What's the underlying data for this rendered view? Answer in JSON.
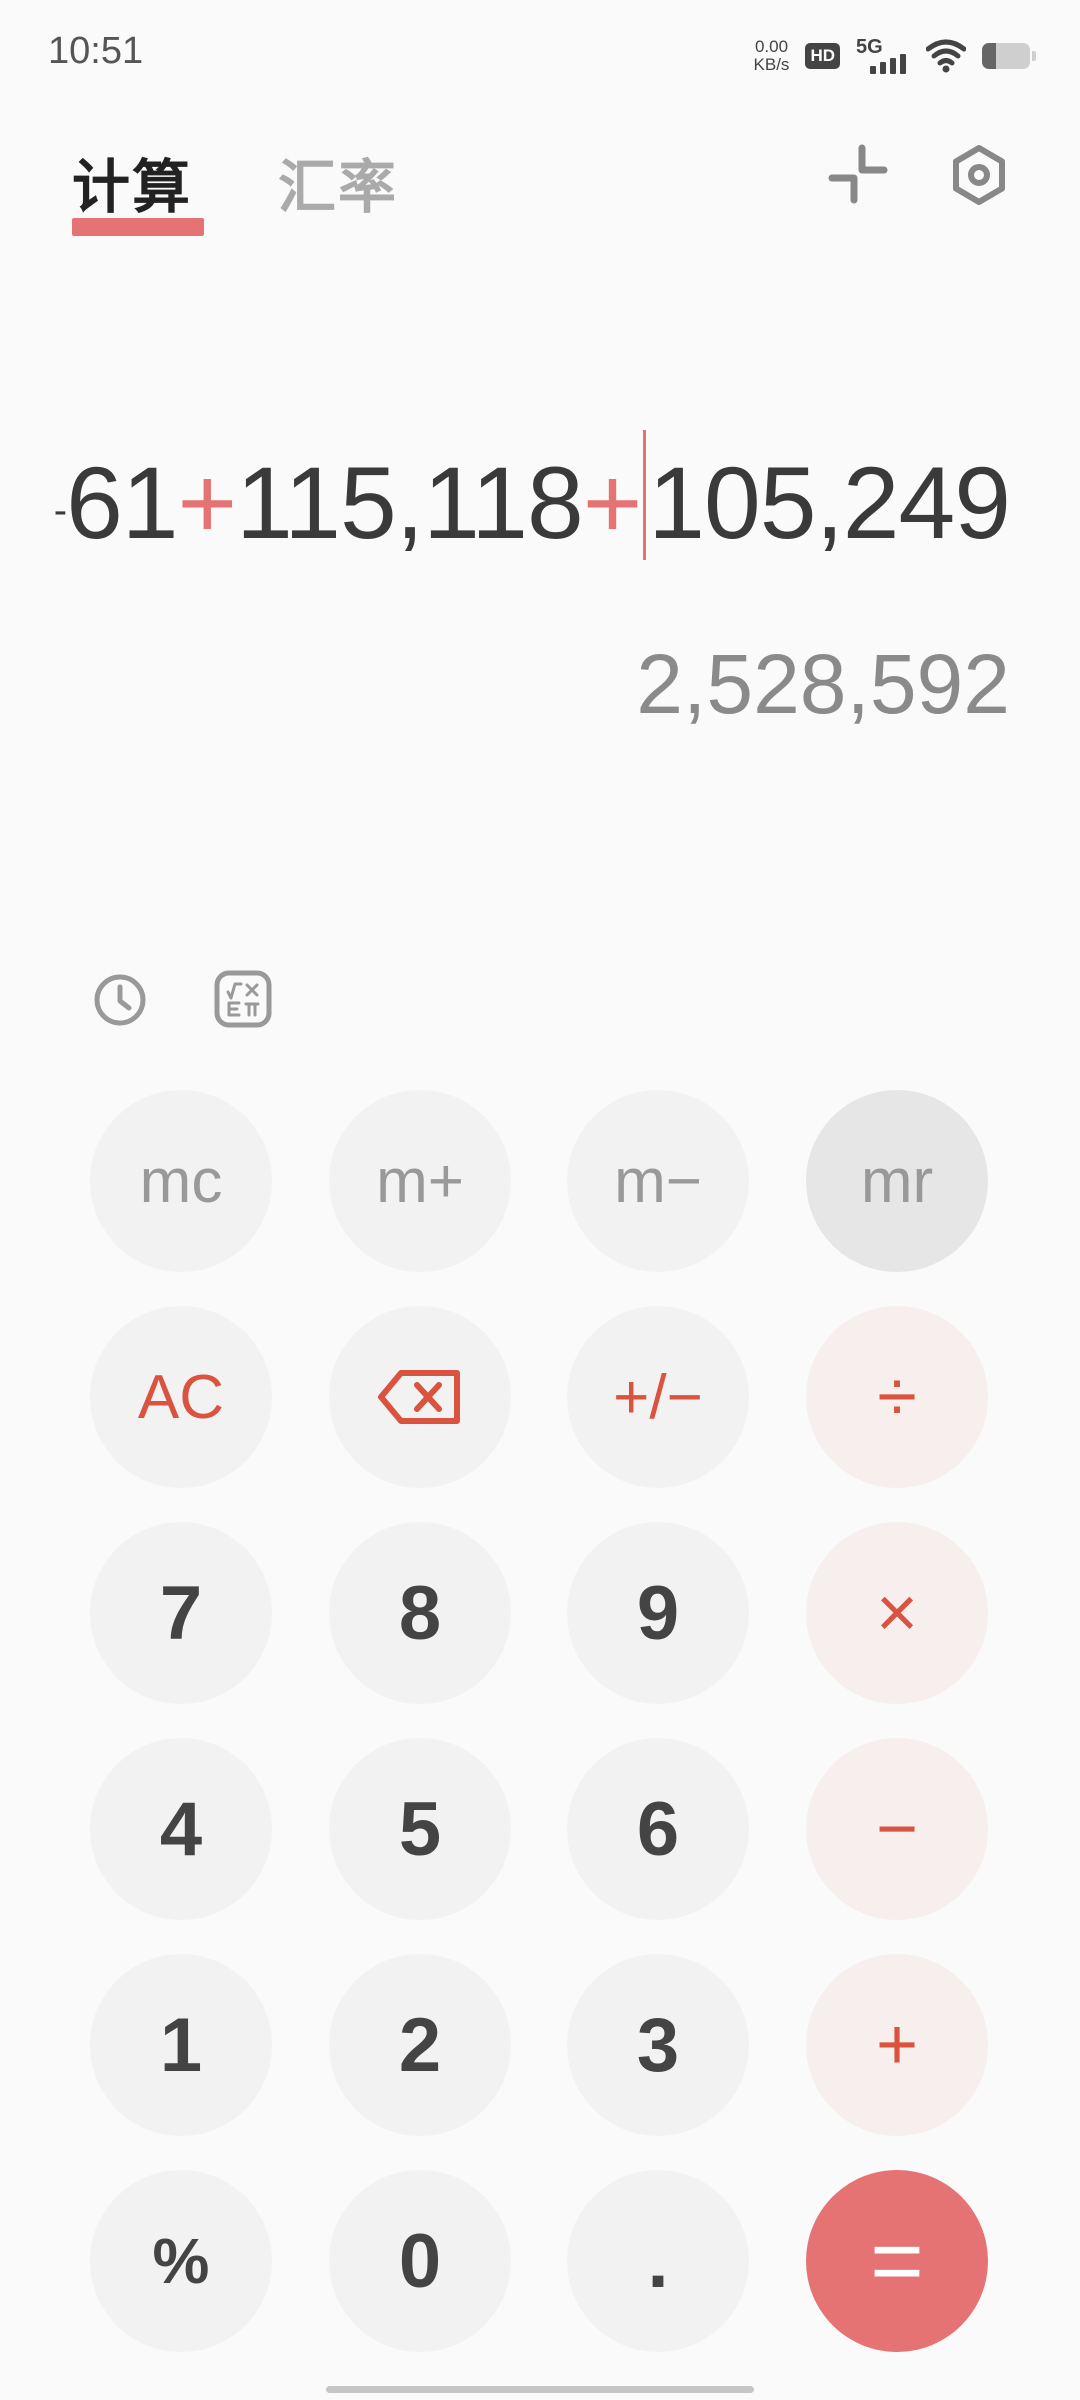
{
  "status_bar": {
    "time": "10:51",
    "net_speed_value": "0.00",
    "net_speed_unit": "KB/s",
    "hd_label": "HD",
    "network_label": "5G",
    "battery_level": 0.3
  },
  "tabs": [
    {
      "label": "计算",
      "active": true
    },
    {
      "label": "汇率",
      "active": false
    }
  ],
  "display": {
    "expression": {
      "minus": "-",
      "term1": "61",
      "op1": "+",
      "term2": "115,118",
      "op2": "+",
      "term3": "105,249"
    },
    "result": "2,528,592"
  },
  "icons": {
    "shrink": "shrink-icon",
    "settings": "settings-icon",
    "history": "history-icon",
    "scientific": "scientific-icon",
    "backspace": "backspace-icon"
  },
  "keys": {
    "mc": "mc",
    "mplus": "m+",
    "mminus": "m−",
    "mr": "mr",
    "ac": "AC",
    "plusminus": "+/−",
    "divide": "÷",
    "k7": "7",
    "k8": "8",
    "k9": "9",
    "multiply": "×",
    "k4": "4",
    "k5": "5",
    "k6": "6",
    "minus": "−",
    "k1": "1",
    "k2": "2",
    "k3": "3",
    "plus": "+",
    "percent": "%",
    "k0": "0",
    "dot": ".",
    "equals": "="
  },
  "colors": {
    "accent": "#e57373",
    "operator_text": "#d9533f",
    "background": "#fafafa",
    "key_background": "#f2f2f2",
    "operator_key_background": "#f7efee"
  }
}
